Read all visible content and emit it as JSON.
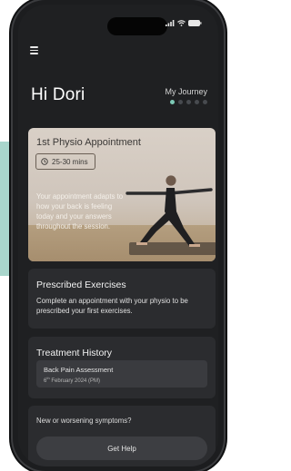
{
  "header": {
    "greeting": "Hi Dori",
    "journey_label": "My Journey",
    "journey_steps": 5,
    "journey_current": 1
  },
  "appointment": {
    "title": "1st Physio Appointment",
    "duration": "25-30 mins",
    "description": "Your appointment adapts to how your back is feeling today and your answers throughout the session."
  },
  "exercises": {
    "title": "Prescribed Exercises",
    "body": "Complete an appointment with your physio to be prescribed your first exercises."
  },
  "history": {
    "title": "Treatment History",
    "item_name": "Back Pain Assessment",
    "item_date": "6th February 2024 (PM)"
  },
  "symptoms": {
    "prompt": "New or worsening symptoms?",
    "button_label": "Get Help"
  },
  "colors": {
    "accent": "#7dc9b6",
    "background": "#1f2022",
    "card": "#2b2c2f",
    "side_block": "#a9d6cc"
  },
  "icons": [
    "menu-icon",
    "clock-icon",
    "signal-icon",
    "wifi-icon",
    "battery-icon"
  ]
}
